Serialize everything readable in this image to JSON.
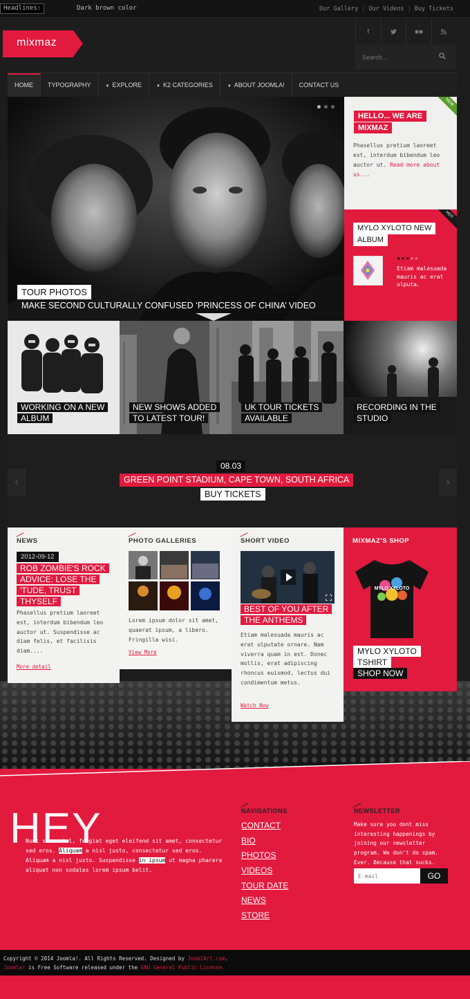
{
  "topbar": {
    "headlines_label": "Headlines:",
    "ticker": "Dark brown color",
    "links": [
      "Our Gallery",
      "Our Videos",
      "Buy Tickets"
    ]
  },
  "logo": "mixmaz",
  "social": [
    "f",
    "t",
    "••",
    "rss"
  ],
  "search": {
    "placeholder": "Search..."
  },
  "nav": [
    {
      "label": "HOME",
      "active": true
    },
    {
      "label": "TYPOGRAPHY"
    },
    {
      "label": "EXPLORE",
      "dropdown": true
    },
    {
      "label": "K2 CATEGORIES",
      "dropdown": true
    },
    {
      "label": "ABOUT JOOMLA!",
      "dropdown": true
    },
    {
      "label": "CONTACT US"
    }
  ],
  "hero": {
    "tag": "TOUR PHOTOS",
    "caption": "MAKE SECOND CULTURALLY CONFUSED ‘PRINCESS OF CHINA’ VIDEO"
  },
  "panel_hello": {
    "badge": "NEW",
    "title_line1": "HELLO... WE ARE",
    "title_line2": "MIXMAZ",
    "text": "Phasellus pretium laoreet est, interdum bibendum leo auctor ut.",
    "link": "Read more about us..."
  },
  "panel_album": {
    "badge": "HOT",
    "title_line1": "MYLO XYLOTO NEW",
    "title_line2": "ALBUM",
    "rating": 3,
    "rating_max": 5,
    "text": "Etiam malesuada mauris ac erat ulputa."
  },
  "tiles": [
    {
      "line1": "WORKING ON A NEW",
      "line2": "ALBUM"
    },
    {
      "line1": "NEW SHOWS ADDED",
      "line2": "TO LATEST TOUR!"
    },
    {
      "line1": "UK TOUR TICKETS",
      "line2": "AVAILABLE"
    },
    {
      "line1": "RECORDING IN THE",
      "line2": "STUDIO"
    }
  ],
  "event": {
    "date": "08.03",
    "venue": "GREEN POINT STADIUM, CAPE TOWN, SOUTH AFRICA",
    "cta": "BUY TICKETS"
  },
  "news": {
    "heading": "NEWS",
    "date": "2012-09-12",
    "title_lines": [
      "ROB ZOMBIE'S ROCK",
      "ADVICE: LOSE THE",
      "'TUDE, TRUST",
      "THYSELF"
    ],
    "text": "Phasellus pretium laoreet est, interdum bibendum leo auctor ut. Suspendisse ac diam felis, et facilisis diam....",
    "link": "More detail"
  },
  "gallery": {
    "heading": "PHOTO GALLERIES",
    "text": "Lorem ipsum dolor sit amet, quaerat ipsum, a libero. Fringilla wisi.",
    "link": "View More"
  },
  "video": {
    "heading": "SHORT VIDEO",
    "title_lines": [
      "BEST OF YOU AFTER",
      "THE ANTHEMS"
    ],
    "text": "Etiam malesuada mauris ac erat ulputate ornare. Nam viverra quam in est. Donec mollis, erat adipiscing rhoncus euismod, lectus dui condimentum metus.",
    "link": "Watch Now"
  },
  "shop": {
    "heading": "MIXMAZ'S SHOP",
    "product_line1": "MYLO XYLOTO",
    "product_line2": "TSHIRT",
    "cta": "SHOP NOW",
    "shirt_print": "MYLO XYLOTO"
  },
  "footer": {
    "hey": "HEY",
    "about_parts": [
      "Nunc sunc nisl, feugiat eget eleifend sit amet, consectetur sed eros. ",
      "Aliquam",
      " a nisl justo, consectetur sed eros. Aliquam a nisl justo. Suspendisse ",
      "in ipsum",
      " ut magna pharera aliquet non sodales lorem ipsum belit."
    ],
    "nav_heading": "NAVIGATIONS",
    "nav_links": [
      "CONTACT",
      "BIO",
      "PHOTOS",
      "VIDEOS",
      "TOUR DATE",
      "NEWS",
      "STORE"
    ],
    "newsletter_heading": "NEWSLETTER",
    "newsletter_text": "Make sure you dont miss interesting happenings by joining our newsletter program. We don't do spam. Ever. Because that sucks.",
    "email_placeholder": "E-mail",
    "go": "GO"
  },
  "copyright": {
    "line1_a": "Copyright © 2014 Joomla!. All Rights Reserved. Designed by ",
    "line1_link": "JoomlArt.com",
    "line1_b": ".",
    "line2_link1": "Joomla!",
    "line2_a": " is Free Software released under the ",
    "line2_link2": "GNU General Public License."
  },
  "colors": {
    "accent": "#e21a3e",
    "dark": "#1c1c1c"
  }
}
